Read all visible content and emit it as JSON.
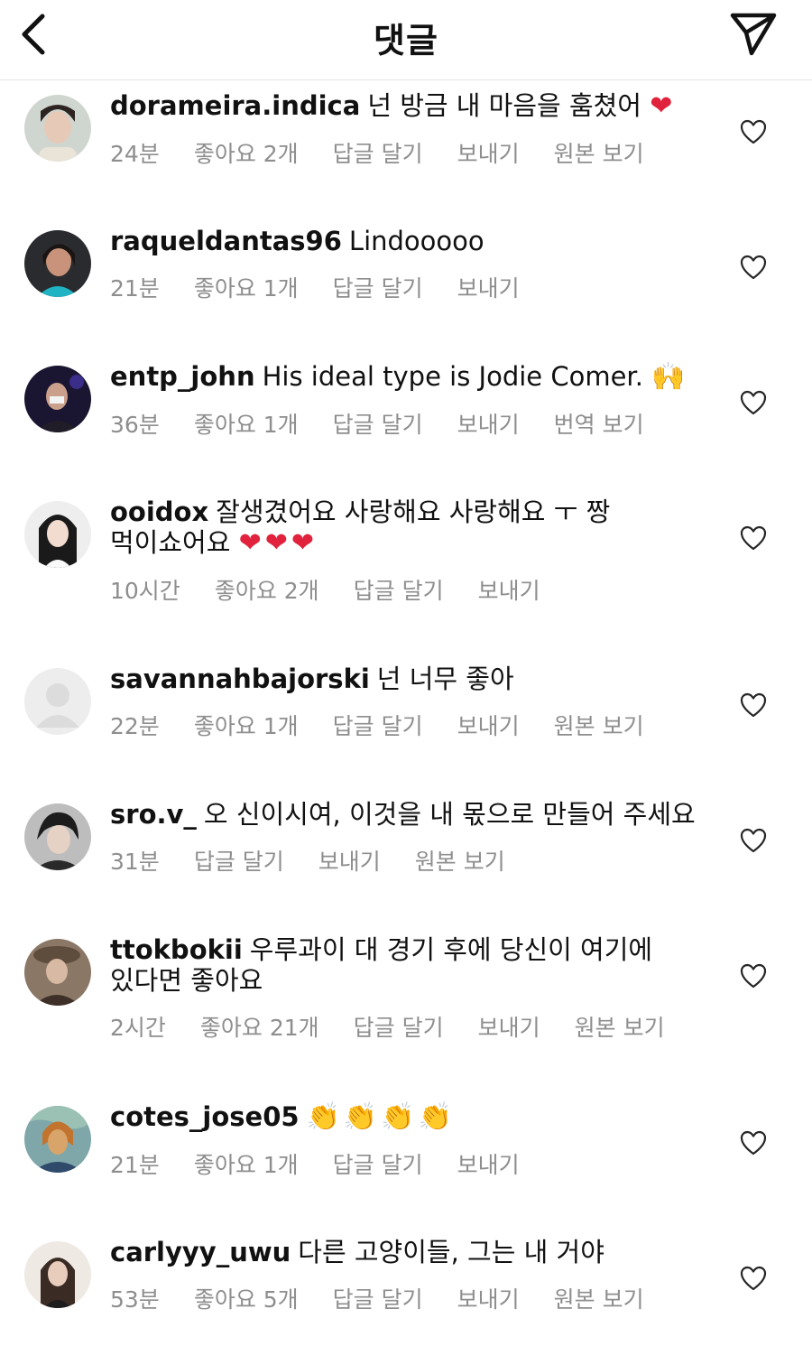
{
  "header": {
    "title": "댓글"
  },
  "comments": [
    {
      "user": "dorameira.indica",
      "text": "넌 방금 내 마음을 훔쳤어",
      "emoji": "❤",
      "time": "24분",
      "likes": "좋아요 2개",
      "reply": "답글 달기",
      "send": "보내기",
      "extra": "원본 보기"
    },
    {
      "user": "raqueldantas96",
      "text": "Lindooooo",
      "emoji": "",
      "time": "21분",
      "likes": "좋아요 1개",
      "reply": "답글 달기",
      "send": "보내기",
      "extra": ""
    },
    {
      "user": "entp_john",
      "text": "His ideal type is Jodie Comer.",
      "emoji": "🙌",
      "time": "36분",
      "likes": "좋아요 1개",
      "reply": "답글 달기",
      "send": "보내기",
      "extra": "번역 보기"
    },
    {
      "user": "ooidox",
      "text": "잘생겼어요 사랑해요 사랑해요 ㅜ 짱 먹이쇼어요",
      "emoji": "❤❤❤",
      "time": "10시간",
      "likes": "좋아요 2개",
      "reply": "답글 달기",
      "send": "보내기",
      "extra": ""
    },
    {
      "user": "savannahbajorski",
      "text": "넌 너무 좋아",
      "emoji": "",
      "time": "22분",
      "likes": "좋아요 1개",
      "reply": "답글 달기",
      "send": "보내기",
      "extra": "원본 보기"
    },
    {
      "user": "sro.v_",
      "text": "오 신이시여, 이것을 내 몫으로 만들어 주세요",
      "emoji": "",
      "time": "31분",
      "likes": "",
      "reply": "답글 달기",
      "send": "보내기",
      "extra": "원본 보기"
    },
    {
      "user": "ttokbokii",
      "text": "우루과이 대 경기 후에 당신이 여기에 있다면 좋아요",
      "emoji": "",
      "time": "2시간",
      "likes": "좋아요 21개",
      "reply": "답글 달기",
      "send": "보내기",
      "extra": "원본 보기"
    },
    {
      "user": "cotes_jose05",
      "text": "",
      "emoji": "👏👏👏👏",
      "time": "21분",
      "likes": "좋아요 1개",
      "reply": "답글 달기",
      "send": "보내기",
      "extra": ""
    },
    {
      "user": "carlyyy_uwu",
      "text": "다른 고양이들, 그는 내 거야",
      "emoji": "",
      "time": "53분",
      "likes": "좋아요 5개",
      "reply": "답글 달기",
      "send": "보내기",
      "extra": "원본 보기"
    }
  ],
  "colors": {
    "meta": "#8e8e8e",
    "heart_emoji": "#e0223c",
    "divider": "#e4e4e4"
  },
  "icons": {
    "back": "chevron-left-icon",
    "send": "paper-plane-icon",
    "like": "heart-outline-icon"
  }
}
